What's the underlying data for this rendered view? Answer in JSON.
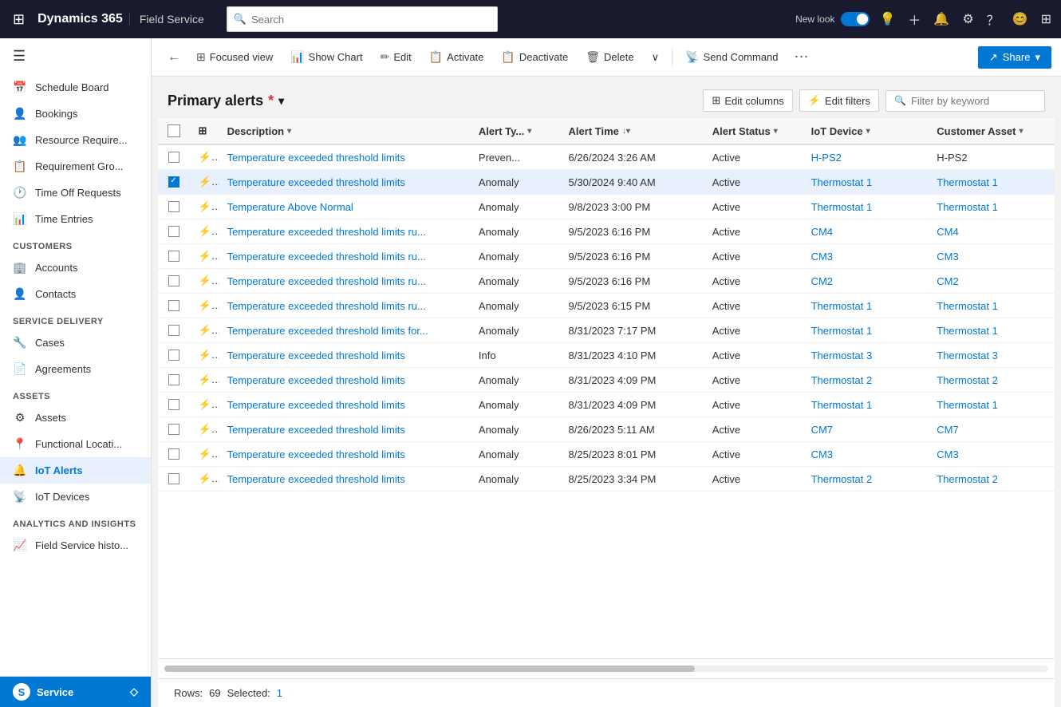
{
  "app": {
    "title": "Dynamics 365",
    "module": "Field Service"
  },
  "topnav": {
    "search_placeholder": "Search",
    "new_look_label": "New look",
    "icons": [
      "lightbulb-icon",
      "plus-icon",
      "bell-icon",
      "settings-icon",
      "help-icon",
      "user-icon",
      "apps-icon"
    ]
  },
  "toolbar": {
    "back_icon": "←",
    "focused_view_label": "Focused view",
    "show_chart_label": "Show Chart",
    "edit_label": "Edit",
    "activate_label": "Activate",
    "deactivate_label": "Deactivate",
    "delete_label": "Delete",
    "more_icon": "∨",
    "send_command_label": "Send Command",
    "ellipsis_icon": "⋯",
    "share_label": "Share",
    "share_icon": "↗"
  },
  "list": {
    "title": "Primary alerts",
    "asterisk": "*",
    "dropdown_icon": "▾",
    "edit_columns_label": "Edit columns",
    "edit_filters_label": "Edit filters",
    "filter_placeholder": "Filter by keyword"
  },
  "columns": [
    {
      "id": "check",
      "label": ""
    },
    {
      "id": "icon",
      "label": ""
    },
    {
      "id": "description",
      "label": "Description",
      "sort": "▾"
    },
    {
      "id": "alert_type",
      "label": "Alert Ty...",
      "sort": "▾"
    },
    {
      "id": "alert_time",
      "label": "Alert Time",
      "sort": "↓▾"
    },
    {
      "id": "alert_status",
      "label": "Alert Status",
      "sort": "▾"
    },
    {
      "id": "iot_device",
      "label": "IoT Device",
      "sort": "▾"
    },
    {
      "id": "customer_asset",
      "label": "Customer Asset",
      "sort": "▾"
    }
  ],
  "rows": [
    {
      "id": 1,
      "selected": false,
      "description": "Temperature exceeded threshold limits",
      "alert_type": "Preven...",
      "alert_time": "6/26/2024 3:26 AM",
      "alert_status": "Active",
      "iot_device": "H-PS2",
      "iot_device_link": true,
      "customer_asset": "H-PS2",
      "customer_asset_link": false
    },
    {
      "id": 2,
      "selected": true,
      "description": "Temperature exceeded threshold limits",
      "alert_type": "Anomaly",
      "alert_time": "5/30/2024 9:40 AM",
      "alert_status": "Active",
      "iot_device": "Thermostat 1",
      "iot_device_link": true,
      "customer_asset": "Thermostat 1",
      "customer_asset_link": true
    },
    {
      "id": 3,
      "selected": false,
      "description": "Temperature Above Normal",
      "alert_type": "Anomaly",
      "alert_time": "9/8/2023 3:00 PM",
      "alert_status": "Active",
      "iot_device": "Thermostat 1",
      "iot_device_link": true,
      "customer_asset": "Thermostat 1",
      "customer_asset_link": true
    },
    {
      "id": 4,
      "selected": false,
      "description": "Temperature exceeded threshold limits ru...",
      "alert_type": "Anomaly",
      "alert_time": "9/5/2023 6:16 PM",
      "alert_status": "Active",
      "iot_device": "CM4",
      "iot_device_link": true,
      "customer_asset": "CM4",
      "customer_asset_link": true
    },
    {
      "id": 5,
      "selected": false,
      "description": "Temperature exceeded threshold limits ru...",
      "alert_type": "Anomaly",
      "alert_time": "9/5/2023 6:16 PM",
      "alert_status": "Active",
      "iot_device": "CM3",
      "iot_device_link": true,
      "customer_asset": "CM3",
      "customer_asset_link": true
    },
    {
      "id": 6,
      "selected": false,
      "description": "Temperature exceeded threshold limits ru...",
      "alert_type": "Anomaly",
      "alert_time": "9/5/2023 6:16 PM",
      "alert_status": "Active",
      "iot_device": "CM2",
      "iot_device_link": true,
      "customer_asset": "CM2",
      "customer_asset_link": true
    },
    {
      "id": 7,
      "selected": false,
      "description": "Temperature exceeded threshold limits ru...",
      "alert_type": "Anomaly",
      "alert_time": "9/5/2023 6:15 PM",
      "alert_status": "Active",
      "iot_device": "Thermostat 1",
      "iot_device_link": true,
      "customer_asset": "Thermostat 1",
      "customer_asset_link": true
    },
    {
      "id": 8,
      "selected": false,
      "description": "Temperature exceeded threshold limits for...",
      "alert_type": "Anomaly",
      "alert_time": "8/31/2023 7:17 PM",
      "alert_status": "Active",
      "iot_device": "Thermostat 1",
      "iot_device_link": true,
      "customer_asset": "Thermostat 1",
      "customer_asset_link": true
    },
    {
      "id": 9,
      "selected": false,
      "description": "Temperature exceeded threshold limits",
      "alert_type": "Info",
      "alert_time": "8/31/2023 4:10 PM",
      "alert_status": "Active",
      "iot_device": "Thermostat 3",
      "iot_device_link": true,
      "customer_asset": "Thermostat 3",
      "customer_asset_link": true
    },
    {
      "id": 10,
      "selected": false,
      "description": "Temperature exceeded threshold limits",
      "alert_type": "Anomaly",
      "alert_time": "8/31/2023 4:09 PM",
      "alert_status": "Active",
      "iot_device": "Thermostat 2",
      "iot_device_link": true,
      "customer_asset": "Thermostat 2",
      "customer_asset_link": true
    },
    {
      "id": 11,
      "selected": false,
      "description": "Temperature exceeded threshold limits",
      "alert_type": "Anomaly",
      "alert_time": "8/31/2023 4:09 PM",
      "alert_status": "Active",
      "iot_device": "Thermostat 1",
      "iot_device_link": true,
      "customer_asset": "Thermostat 1",
      "customer_asset_link": true
    },
    {
      "id": 12,
      "selected": false,
      "description": "Temperature exceeded threshold limits",
      "alert_type": "Anomaly",
      "alert_time": "8/26/2023 5:11 AM",
      "alert_status": "Active",
      "iot_device": "CM7",
      "iot_device_link": true,
      "customer_asset": "CM7",
      "customer_asset_link": true
    },
    {
      "id": 13,
      "selected": false,
      "description": "Temperature exceeded threshold limits",
      "alert_type": "Anomaly",
      "alert_time": "8/25/2023 8:01 PM",
      "alert_status": "Active",
      "iot_device": "CM3",
      "iot_device_link": true,
      "customer_asset": "CM3",
      "customer_asset_link": true
    },
    {
      "id": 14,
      "selected": false,
      "description": "Temperature exceeded threshold limits",
      "alert_type": "Anomaly",
      "alert_time": "8/25/2023 3:34 PM",
      "alert_status": "Active",
      "iot_device": "Thermostat 2",
      "iot_device_link": true,
      "customer_asset": "Thermostat 2",
      "customer_asset_link": true
    }
  ],
  "sidebar": {
    "items": [
      {
        "id": "schedule-board",
        "label": "Schedule Board",
        "icon": "📅"
      },
      {
        "id": "bookings",
        "label": "Bookings",
        "icon": "👤"
      },
      {
        "id": "resource-require",
        "label": "Resource Require...",
        "icon": "👥"
      },
      {
        "id": "requirement-gro",
        "label": "Requirement Gro...",
        "icon": "📋"
      },
      {
        "id": "time-off-requests",
        "label": "Time Off Requests",
        "icon": "🕐"
      },
      {
        "id": "time-entries",
        "label": "Time Entries",
        "icon": "📊"
      }
    ],
    "sections": [
      {
        "label": "Customers",
        "items": [
          {
            "id": "accounts",
            "label": "Accounts",
            "icon": "🏢"
          },
          {
            "id": "contacts",
            "label": "Contacts",
            "icon": "👤"
          }
        ]
      },
      {
        "label": "Service Delivery",
        "items": [
          {
            "id": "cases",
            "label": "Cases",
            "icon": "🔧"
          },
          {
            "id": "agreements",
            "label": "Agreements",
            "icon": "📄"
          }
        ]
      },
      {
        "label": "Assets",
        "items": [
          {
            "id": "assets",
            "label": "Assets",
            "icon": "⚙"
          },
          {
            "id": "functional-locati",
            "label": "Functional Locati...",
            "icon": "📍"
          },
          {
            "id": "iot-alerts",
            "label": "IoT Alerts",
            "icon": "🔔",
            "active": true
          },
          {
            "id": "iot-devices",
            "label": "IoT Devices",
            "icon": "📡"
          }
        ]
      },
      {
        "label": "Analytics and Insights",
        "items": [
          {
            "id": "field-service-histo",
            "label": "Field Service histo...",
            "icon": "📈"
          }
        ]
      }
    ],
    "bottom": {
      "label": "Service",
      "icon": "S",
      "pin_icon": "◇"
    }
  },
  "footer": {
    "rows_label": "Rows:",
    "rows_count": "69",
    "selected_label": "Selected:",
    "selected_count": "1"
  }
}
